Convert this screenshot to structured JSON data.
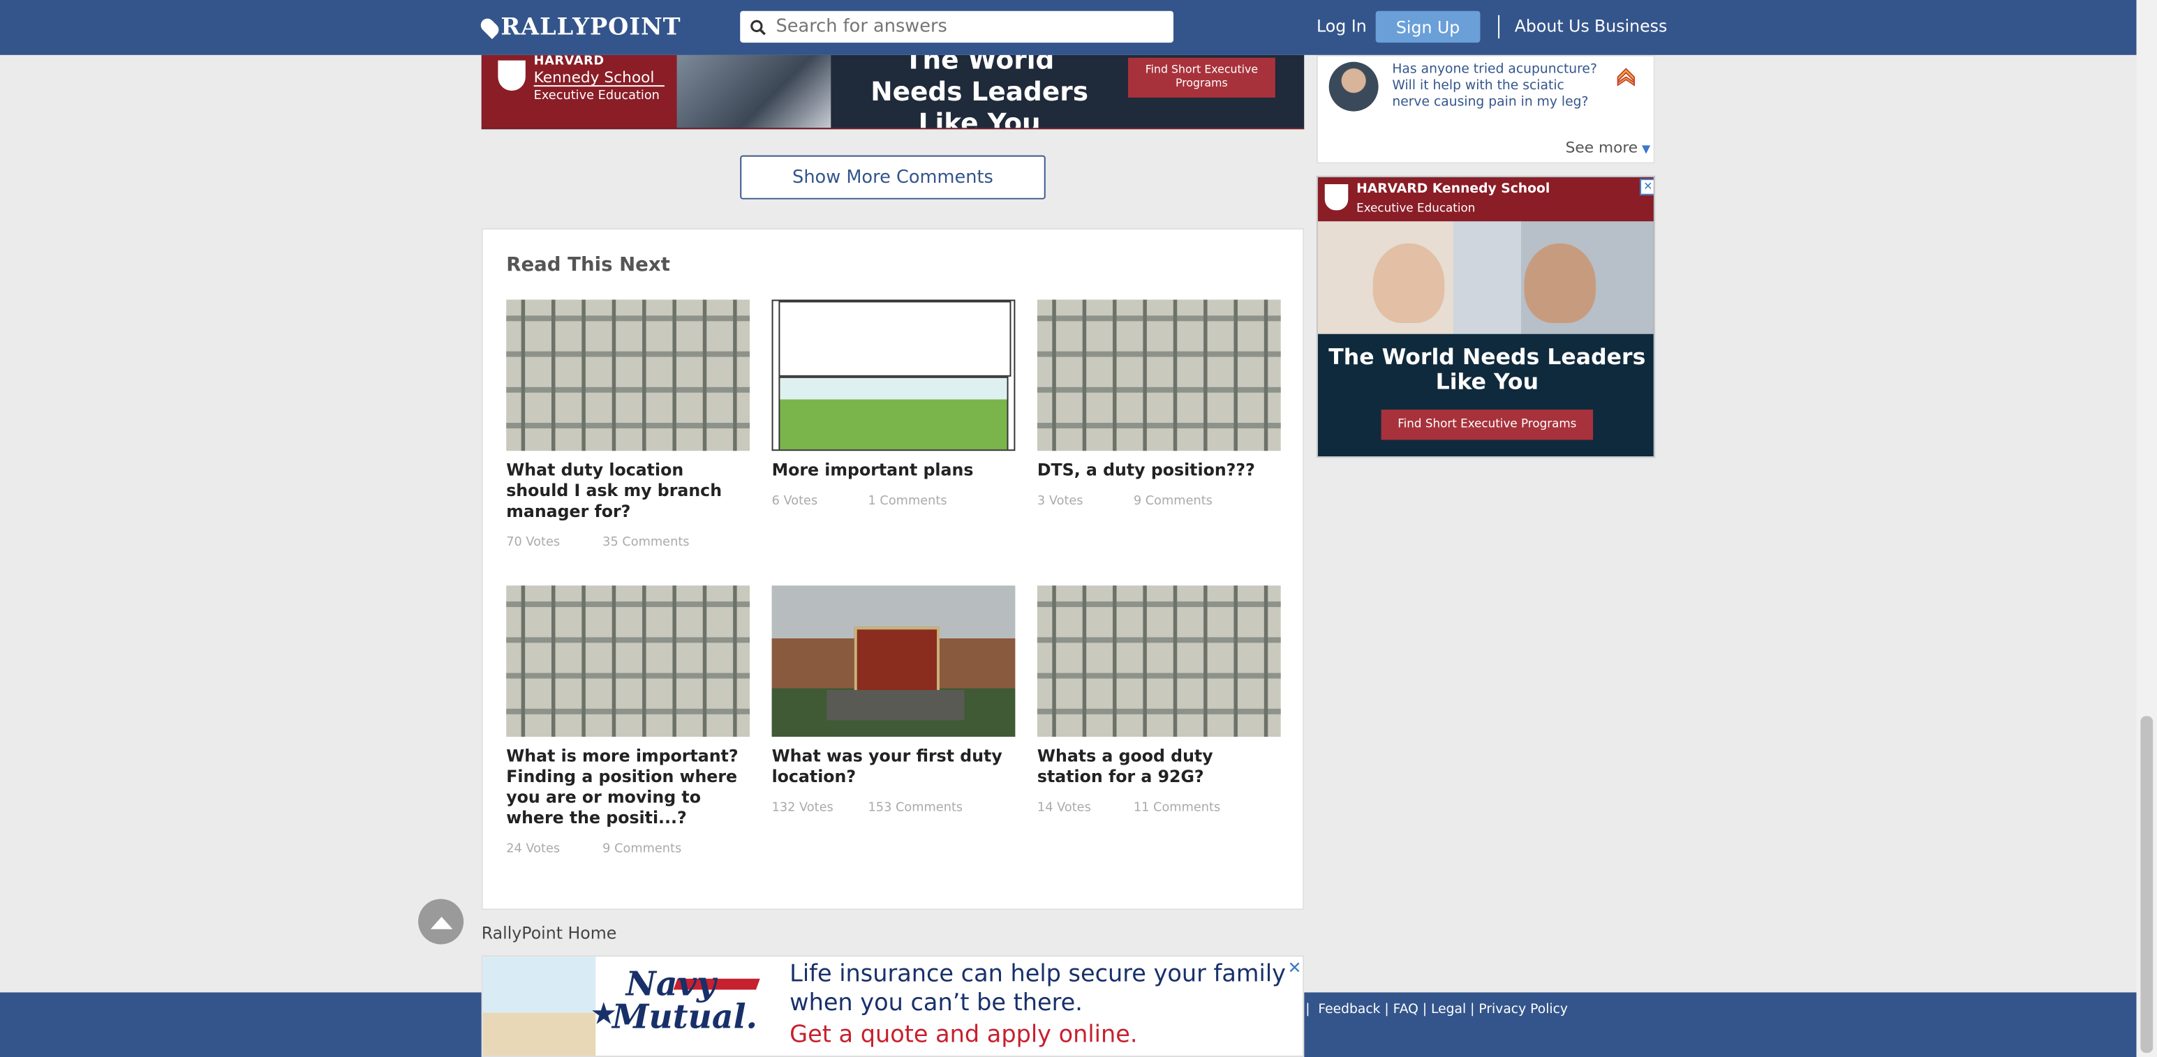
{
  "nav": {
    "logo": "RALLYPOINT",
    "search_placeholder": "Search for answers",
    "login": "Log In",
    "signup": "Sign Up",
    "about": "About Us",
    "business": "Business"
  },
  "ad_top": {
    "org_line1": "HARVARD",
    "org_line2": "Kennedy School",
    "org_line3": "Executive Education",
    "slogan": "The World Needs Leaders Like You",
    "cta": "Find Short Executive Programs"
  },
  "show_more": "Show More Comments",
  "read_next": {
    "title": "Read This Next",
    "cards": [
      {
        "title": "What duty location should I ask my branch manager for?",
        "votes": "70 Votes",
        "comments": "35 Comments"
      },
      {
        "title": "More important plans",
        "votes": "6 Votes",
        "comments": "1 Comments"
      },
      {
        "title": "DTS, a duty position???",
        "votes": "3 Votes",
        "comments": "9 Comments"
      },
      {
        "title": "What is more important? Finding a position where you are or moving to where the positi...?",
        "votes": "24 Votes",
        "comments": "9 Comments"
      },
      {
        "title": "What was your first duty location?",
        "votes": "132 Votes",
        "comments": "153 Comments"
      },
      {
        "title": "Whats a good duty station for a 92G?",
        "votes": "14 Votes",
        "comments": "11 Comments"
      }
    ]
  },
  "side": {
    "question": "Has anyone tried acupuncture? Will it help with the sciatic nerve causing pain in my leg?",
    "see_more": "See more"
  },
  "ad_side": {
    "org": "HARVARD Kennedy School",
    "sub": "Executive Education",
    "slogan": "The World Needs Leaders Like You",
    "cta": "Find Short Executive Programs",
    "close": "✕"
  },
  "home_link": "RallyPoint Home",
  "ad_bottom": {
    "brand1": "Navy",
    "brand2": "Mutual.",
    "line1": "Life insurance can help secure your family",
    "line2": "when you can’t be there.",
    "line3": "Get a quote and apply online.",
    "close": "✕"
  },
  "footer": {
    "links": [
      "Feedback",
      "FAQ",
      "Legal",
      "Privacy Policy"
    ]
  }
}
